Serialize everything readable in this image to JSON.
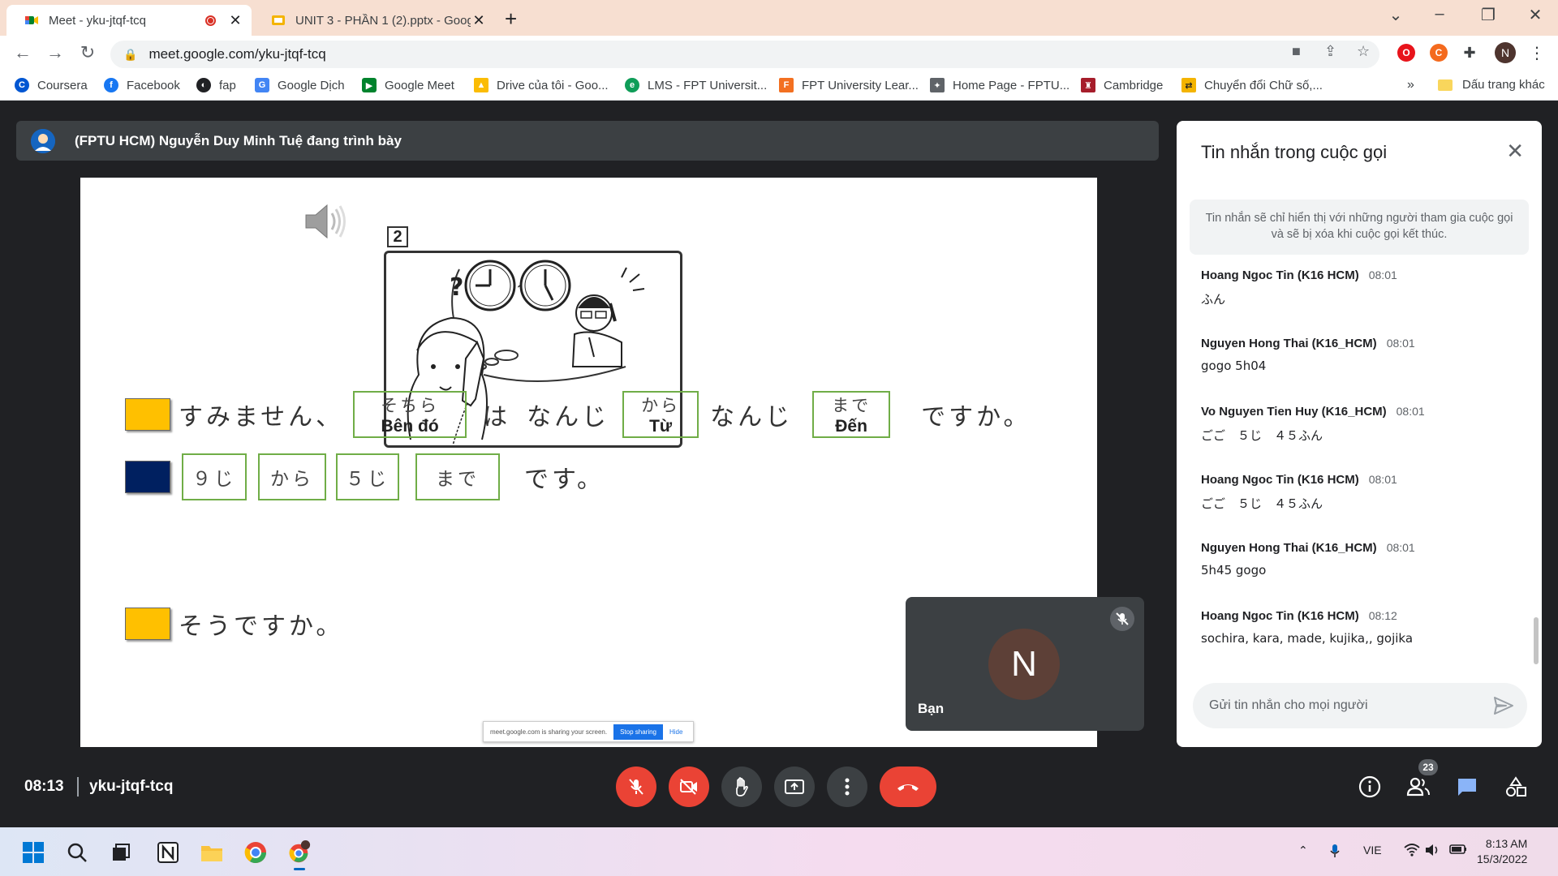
{
  "browser": {
    "tabs": [
      {
        "title": "Meet - yku-jtqf-tcq",
        "active": true
      },
      {
        "title": "UNIT 3 - PHẦN 1 (2).pptx - Goog",
        "active": false
      }
    ],
    "new_tab": "+",
    "url": "meet.google.com/yku-jtqf-tcq",
    "profile_initial": "N"
  },
  "bookmarks": {
    "items": [
      {
        "label": "Coursera",
        "color": "#0056d2",
        "icon": "coursera-icon"
      },
      {
        "label": "Facebook",
        "color": "#1877f2",
        "icon": "facebook-icon"
      },
      {
        "label": "fap",
        "color": "#202124",
        "icon": "globe-icon"
      },
      {
        "label": "Google Dịch",
        "color": "#4285f4",
        "icon": "translate-icon"
      },
      {
        "label": "Google Meet",
        "color": "#00832d",
        "icon": "meet-icon"
      },
      {
        "label": "Drive của tôi - Goo...",
        "color": "#fbbc04",
        "icon": "drive-icon"
      },
      {
        "label": "LMS - FPT Universit...",
        "color": "#0f9d58",
        "icon": "lms-icon"
      },
      {
        "label": "FPT University Lear...",
        "color": "#f37021",
        "icon": "fpt-icon"
      },
      {
        "label": "Home Page - FPTU...",
        "color": "#5f6368",
        "icon": "fptu-icon"
      },
      {
        "label": "Cambridge",
        "color": "#a61d2b",
        "icon": "cambridge-icon"
      },
      {
        "label": "Chuyển đổi Chữ số,...",
        "color": "#f4b400",
        "icon": "convert-icon"
      }
    ],
    "overflow": "»",
    "other_folder": "Dấu trang khác"
  },
  "meet": {
    "presenter_banner": "(FPTU HCM) Nguyễn Duy Minh Tuệ đang trình bày",
    "slide": {
      "picture_number": "2",
      "row1": {
        "swatch_color": "#ffc000",
        "text_start": "すみません、",
        "box1_top": "そちら",
        "box1_bottom": "Bên đó",
        "text_wa": "は",
        "text_nanji1": "なんじ",
        "box2_top": "から",
        "box2_bottom": "Từ",
        "text_nanji2": "なんじ",
        "box3_top": "まで",
        "box3_bottom": "Đến",
        "text_end": "ですか。"
      },
      "row2": {
        "swatch_color": "#002060",
        "boxes": [
          "９じ",
          "から",
          "５じ",
          "まで"
        ],
        "text_end": "です。"
      },
      "row3": {
        "swatch_color": "#ffc000",
        "text": "そうですか。"
      },
      "share_notice": {
        "text": "meet.google.com is sharing your screen.",
        "stop": "Stop sharing",
        "hide": "Hide"
      }
    },
    "self_tile": {
      "initial": "N",
      "name": "Bạn",
      "avatar_color": "#5d4037"
    },
    "clock": "08:13",
    "meeting_code": "yku-jtqf-tcq",
    "participant_count": "23"
  },
  "chat": {
    "title": "Tin nhắn trong cuộc gọi",
    "notice": "Tin nhắn sẽ chỉ hiển thị với những người tham gia cuộc gọi và sẽ bị xóa khi cuộc gọi kết thúc.",
    "messages": [
      {
        "sender": "Hoang Ngoc Tin (K16 HCM)",
        "time": "08:01",
        "text": "ふん"
      },
      {
        "sender": "Nguyen Hong Thai (K16_HCM)",
        "time": "08:01",
        "text": "gogo 5h04"
      },
      {
        "sender": "Vo Nguyen Tien Huy (K16_HCM)",
        "time": "08:01",
        "text": "ごご　５じ　４５ふん"
      },
      {
        "sender": "Hoang Ngoc Tin (K16 HCM)",
        "time": "08:01",
        "text": "ごご　５じ　４５ふん"
      },
      {
        "sender": "Nguyen Hong Thai (K16_HCM)",
        "time": "08:01",
        "text": "5h45 gogo"
      },
      {
        "sender": "Hoang Ngoc Tin (K16 HCM)",
        "time": "08:12",
        "text": "sochira, kara, made, kujika,, gojika"
      }
    ],
    "input_placeholder": "Gửi tin nhắn cho mọi người"
  },
  "taskbar": {
    "language": "VIE",
    "time": "8:13 AM",
    "date": "15/3/2022"
  }
}
